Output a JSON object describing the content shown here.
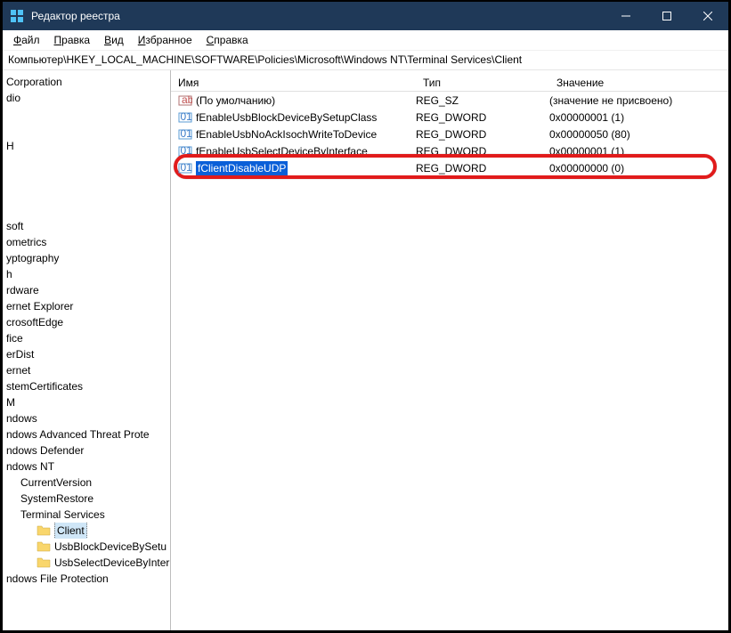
{
  "titlebar": {
    "title": "Редактор реестра"
  },
  "menu": {
    "file": "Файл",
    "edit": "Правка",
    "view": "Вид",
    "fav": "Избранное",
    "help": "Справка"
  },
  "address": "Компьютер\\HKEY_LOCAL_MACHINE\\SOFTWARE\\Policies\\Microsoft\\Windows NT\\Terminal Services\\Client",
  "tree": {
    "items": [
      {
        "label": "Corporation",
        "indent": 0
      },
      {
        "label": "dio",
        "indent": 0
      },
      {
        "label": "",
        "indent": 0
      },
      {
        "label": "",
        "indent": 0
      },
      {
        "label": "H",
        "indent": 0
      },
      {
        "label": "",
        "indent": 0
      },
      {
        "label": "",
        "indent": 0
      },
      {
        "label": "",
        "indent": 0
      },
      {
        "label": "",
        "indent": 0
      },
      {
        "label": "soft",
        "indent": 0
      },
      {
        "label": "ometrics",
        "indent": 0
      },
      {
        "label": "yptography",
        "indent": 0
      },
      {
        "label": "h",
        "indent": 0
      },
      {
        "label": "rdware",
        "indent": 0
      },
      {
        "label": "ernet Explorer",
        "indent": 0
      },
      {
        "label": "crosoftEdge",
        "indent": 0
      },
      {
        "label": "fice",
        "indent": 0
      },
      {
        "label": "erDist",
        "indent": 0
      },
      {
        "label": "ernet",
        "indent": 0
      },
      {
        "label": "stemCertificates",
        "indent": 0
      },
      {
        "label": "M",
        "indent": 0
      },
      {
        "label": "ndows",
        "indent": 0
      },
      {
        "label": "ndows Advanced Threat Prote",
        "indent": 0
      },
      {
        "label": "ndows Defender",
        "indent": 0
      },
      {
        "label": "ndows NT",
        "indent": 0
      },
      {
        "label": "CurrentVersion",
        "indent": 1
      },
      {
        "label": "SystemRestore",
        "indent": 1
      },
      {
        "label": "Terminal Services",
        "indent": 1
      },
      {
        "label": "Client",
        "indent": 2,
        "folder": true,
        "selected": true
      },
      {
        "label": "UsbBlockDeviceBySetu",
        "indent": 2,
        "folder": true,
        "child": true
      },
      {
        "label": "UsbSelectDeviceByInter",
        "indent": 2,
        "folder": true,
        "child": true
      },
      {
        "label": "ndows File Protection",
        "indent": 0
      }
    ]
  },
  "columns": {
    "name": "Имя",
    "type": "Тип",
    "value": "Значение"
  },
  "rows": [
    {
      "icon": "str",
      "name": "(По умолчанию)",
      "type": "REG_SZ",
      "value": "(значение не присвоено)"
    },
    {
      "icon": "dw",
      "name": "fEnableUsbBlockDeviceBySetupClass",
      "type": "REG_DWORD",
      "value": "0x00000001 (1)"
    },
    {
      "icon": "dw",
      "name": "fEnableUsbNoAckIsochWriteToDevice",
      "type": "REG_DWORD",
      "value": "0x00000050 (80)"
    },
    {
      "icon": "dw",
      "name": "fEnableUsbSelectDeviceByInterface",
      "type": "REG_DWORD",
      "value": "0x00000001 (1)"
    },
    {
      "icon": "dw",
      "name": "fClientDisableUDP",
      "type": "REG_DWORD",
      "value": "0x00000000 (0)",
      "selected": true
    }
  ]
}
